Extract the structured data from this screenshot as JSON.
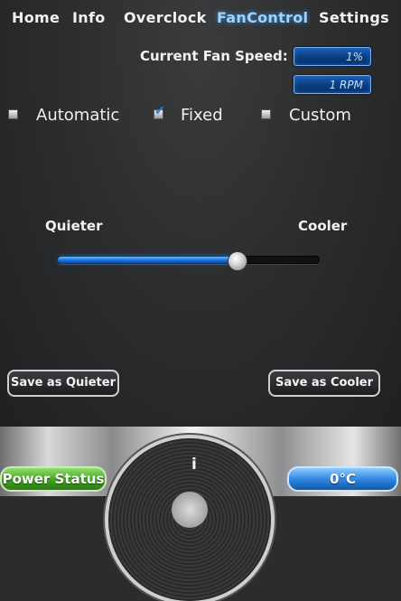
{
  "nav": {
    "items": [
      "Home",
      "Info",
      "Overclock",
      "FanControl",
      "Settings"
    ],
    "active": "FanControl"
  },
  "fan_speed": {
    "label": "Current Fan Speed:",
    "percent": "1%",
    "rpm": "1 RPM"
  },
  "modes": {
    "automatic": {
      "label": "Automatic",
      "checked": false
    },
    "fixed": {
      "label": "Fixed",
      "checked": true
    },
    "custom": {
      "label": "Custom",
      "checked": false
    }
  },
  "slider": {
    "left_label": "Quieter",
    "right_label": "Cooler",
    "level_fraction": 0.69
  },
  "buttons": {
    "save_quieter": "Save as Quieter",
    "save_cooler": "Save as Cooler"
  },
  "bottom_bar": {
    "power_status": "Power Status",
    "info_label": "i",
    "temperature": "0°C"
  },
  "colors": {
    "accent_blue": "#1b6fd6",
    "active_tab": "#9fd3ff",
    "power_green": "#3fa21f"
  }
}
